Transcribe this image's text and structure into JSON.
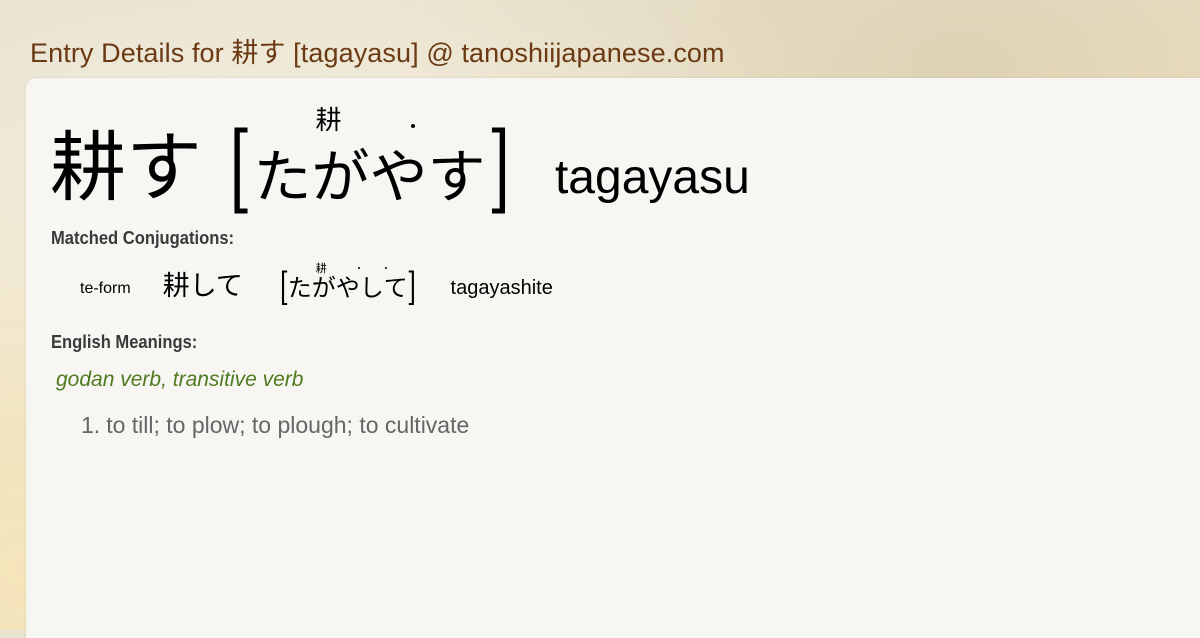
{
  "page": {
    "title": "Entry Details for 耕す [tagayasu] @ tanoshiijapanese.com"
  },
  "entry": {
    "kanji": "耕す",
    "reading_chars": [
      "た",
      "が",
      "や",
      "す"
    ],
    "furigana": "耕",
    "romaji": "tagayasu"
  },
  "sections": {
    "conjugations_label": "Matched Conjugations:",
    "meanings_label": "English Meanings:"
  },
  "conjugations": [
    {
      "form": "te-form",
      "kanji": "耕して",
      "reading_chars": [
        "た",
        "が",
        "や",
        "し",
        "て"
      ],
      "furigana": "耕",
      "romaji": "tagayashite"
    }
  ],
  "meanings": {
    "part_of_speech": "godan verb, transitive verb",
    "items": [
      {
        "number": "1.",
        "text": "to till; to plow; to plough; to cultivate"
      }
    ]
  },
  "colors": {
    "title": "#6b3a14",
    "part_of_speech": "#4f7a1f",
    "meaning_text": "#666666",
    "card_background": "#f7f6f3"
  }
}
